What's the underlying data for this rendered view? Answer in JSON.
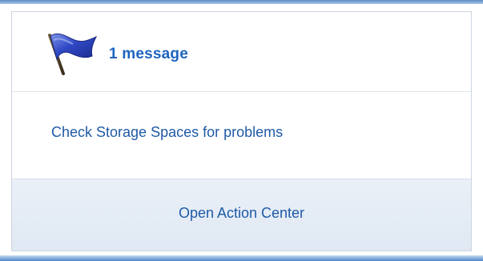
{
  "header": {
    "count_text": "1 message",
    "icon": "flag-icon"
  },
  "messages": [
    {
      "text": "Check Storage Spaces for problems"
    }
  ],
  "footer": {
    "open_label": "Open Action Center"
  },
  "colors": {
    "link": "#1f5aa6",
    "count": "#1e64bf",
    "footer_bg": "#e4ecf5",
    "flag": "#2a3fb5"
  }
}
